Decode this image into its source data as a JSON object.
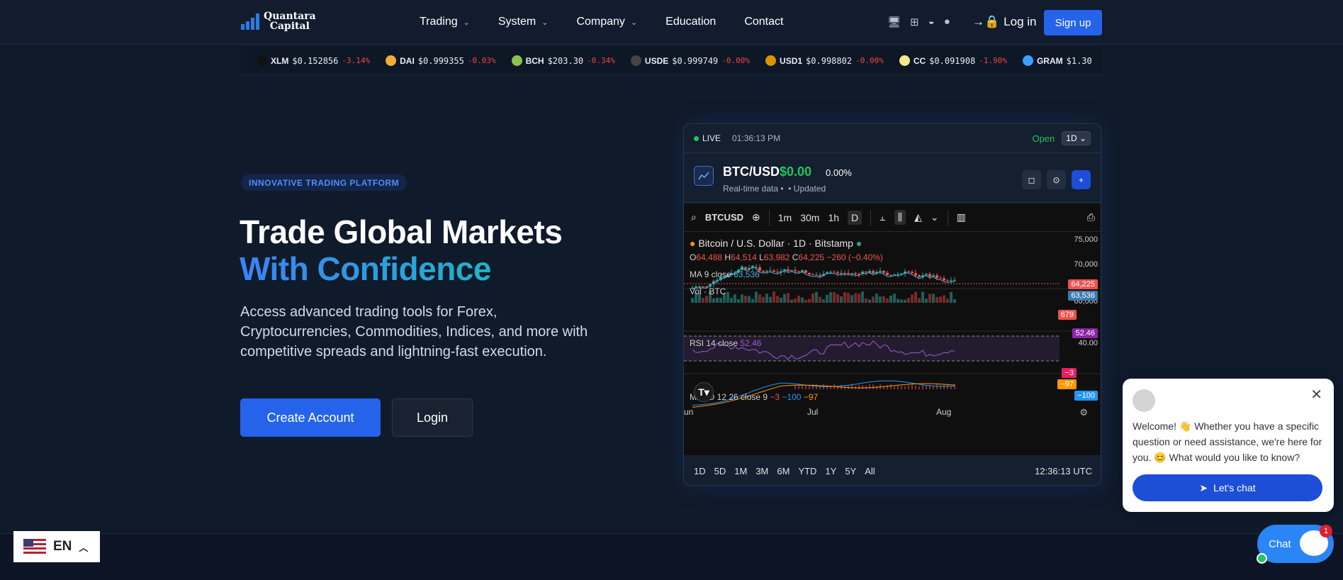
{
  "nav": {
    "logo_line1": "Quantara",
    "logo_line2": "Capital",
    "menu": [
      {
        "label": "Trading",
        "has_dropdown": true
      },
      {
        "label": "System",
        "has_dropdown": true
      },
      {
        "label": "Company",
        "has_dropdown": true
      },
      {
        "label": "Education",
        "has_dropdown": false
      },
      {
        "label": "Contact",
        "has_dropdown": false
      }
    ],
    "login_label": "Log in",
    "signup_label": "Sign up"
  },
  "ticker": [
    {
      "symbol": "XLM",
      "price": "$0.152856",
      "change": "-3.14%",
      "color": "#111111"
    },
    {
      "symbol": "DAI",
      "price": "$0.999355",
      "change": "-0.03%",
      "color": "#f5ac37"
    },
    {
      "symbol": "BCH",
      "price": "$203.30",
      "change": "-0.34%",
      "color": "#8dc351"
    },
    {
      "symbol": "USDE",
      "price": "$0.999749",
      "change": "-0.00%",
      "color": "#444444"
    },
    {
      "symbol": "USD1",
      "price": "$0.998802",
      "change": "-0.00%",
      "color": "#d99500"
    },
    {
      "symbol": "CC",
      "price": "$0.091908",
      "change": "-1.90%",
      "color": "#f4e98a"
    },
    {
      "symbol": "GRAM",
      "price": "$1.30",
      "change": "",
      "color": "#3aa0ff"
    }
  ],
  "hero": {
    "badge": "INNOVATIVE TRADING PLATFORM",
    "title_line1": "Trade Global Markets",
    "title_line2": "With Confidence",
    "description": "Access advanced trading tools for Forex, Cryptocurrencies, Commodities, Indices, and more with competitive spreads and lightning-fast execution.",
    "create_account": "Create Account",
    "login": "Login"
  },
  "widget": {
    "live": "LIVE",
    "time": "01:36:13 PM",
    "status": "Open",
    "timeframe": "1D",
    "pair": "BTC/USD",
    "price": "$0.00",
    "change": "0.00%",
    "sub1": "Real-time data",
    "sub2": "Updated",
    "toolbar_symbol": "BTCUSD",
    "toolbar_intervals": [
      "1m",
      "30m",
      "1h",
      "D"
    ],
    "chart_title": "Bitcoin / U.S. Dollar · 1D · Bitstamp",
    "ohlc": {
      "o": "64,488",
      "h": "64,514",
      "l": "63,982",
      "c": "64,225",
      "chg": "−260 (−0.40%)"
    },
    "ma_label": "MA 9 close",
    "ma_value": "63,536",
    "vol_label": "Vol · BTC",
    "rsi_label": "RSI 14 close",
    "rsi_value": "52.46",
    "macd_label": "MACD 12 26 close 9",
    "macd_values": [
      "−3",
      "−100",
      "−97"
    ],
    "y_ticks": [
      "75,000",
      "70,000",
      "65,000",
      "60,000"
    ],
    "price_tag": "64,225",
    "ma_tag": "63,536",
    "vol_tag": "679",
    "rsi_tag": "52.46",
    "rsi_low": "40.00",
    "macd_tags": [
      "−3",
      "−97",
      "−100"
    ],
    "x_labels": [
      "un",
      "Jul",
      "Aug"
    ],
    "ranges": [
      "1D",
      "5D",
      "1M",
      "3M",
      "6M",
      "YTD",
      "1Y",
      "5Y",
      "All"
    ],
    "utc": "12:36:13 UTC"
  },
  "chat": {
    "message": "Welcome! 👋 Whether you have a specific question or need assistance, we're here for you. 😊 What would you like to know?",
    "button": "Let's chat",
    "launcher": "Chat",
    "count": "1"
  },
  "lang": {
    "code": "EN"
  }
}
